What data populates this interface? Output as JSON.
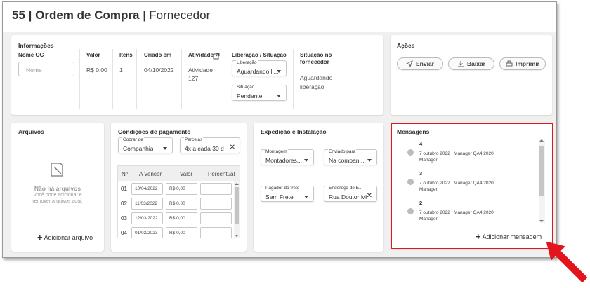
{
  "header": {
    "title_bold": "55 | Ordem de Compra",
    "title_sub": "Fornecedor"
  },
  "informacoes": {
    "title": "Informações",
    "columns": {
      "nome_oc": {
        "label": "Nome OC",
        "placeholder": "Nome"
      },
      "valor": {
        "label": "Valor",
        "value": "R$ 0,00"
      },
      "itens": {
        "label": "Itens",
        "value": "1"
      },
      "criado_em": {
        "label": "Criado em",
        "value": "04/10/2022"
      },
      "atividade": {
        "label": "Atividade",
        "value_line1": "Atividade",
        "value_line2": "127"
      },
      "liberacao_situacao": {
        "label": "Liberação / Situação",
        "liberacao": {
          "label": "Liberação",
          "value": "Aguardando li..."
        },
        "situacao": {
          "label": "Situação",
          "value": "Pendente"
        }
      },
      "situacao_fornecedor": {
        "label_line1": "Situação no",
        "label_line2": "fornecedor",
        "value_line1": "Aguardando",
        "value_line2": "liberação"
      }
    }
  },
  "acoes": {
    "title": "Ações",
    "buttons": {
      "enviar": "Enviar",
      "baixar": "Baixar",
      "imprimir": "Imprimir"
    }
  },
  "arquivos": {
    "title": "Arquivos",
    "empty_title": "Não há arquivos",
    "empty_text_line1": "Você pode adicionar e",
    "empty_text_line2": "remover arquivos aqui.",
    "add_label": "Adicionar arquivo"
  },
  "condicoes": {
    "title": "Condições de pagamento",
    "cobrar_de": {
      "label": "Cobrar de",
      "value": "Companhia"
    },
    "parcelas": {
      "label": "Parcelas",
      "value": "4x a cada 30 d"
    },
    "table": {
      "headers": [
        "Nº",
        "A Vencer",
        "Valor",
        "Percentual"
      ],
      "rows": [
        {
          "n": "01",
          "date": "10/04/2022",
          "value": "R$ 0,00"
        },
        {
          "n": "02",
          "date": "11/03/2022",
          "value": "R$ 0,00"
        },
        {
          "n": "03",
          "date": "12/03/2022",
          "value": "R$ 0,00"
        },
        {
          "n": "04",
          "date": "01/02/2023",
          "value": "R$ 0,00"
        }
      ]
    }
  },
  "expedicao": {
    "title": "Expedição e Instalação",
    "montagem": {
      "label": "Montagem",
      "value": "Montadores..."
    },
    "enviado_para": {
      "label": "Enviado para",
      "value": "Na compan..."
    },
    "pagador_frete": {
      "label": "Pagador do frete",
      "value": "Sem Frete"
    },
    "endereco": {
      "label": "Endereço de E...",
      "value": "Rua Doutor Mi"
    }
  },
  "mensagens": {
    "title": "Mensagens",
    "items": [
      {
        "num": "4",
        "meta": "7 outubro 2022 | Manager QA4 2020",
        "author": "Manager"
      },
      {
        "num": "3",
        "meta": "7 outubro 2022 | Manager QA4 2020",
        "author": "Manager"
      },
      {
        "num": "2",
        "meta": "7 outubro 2022 | Manager QA4 2020",
        "author": "Manager"
      }
    ],
    "add_label": "Adicionar mensagem"
  },
  "colors": {
    "highlight": "#e3141b",
    "background": "#f0f0f0"
  }
}
